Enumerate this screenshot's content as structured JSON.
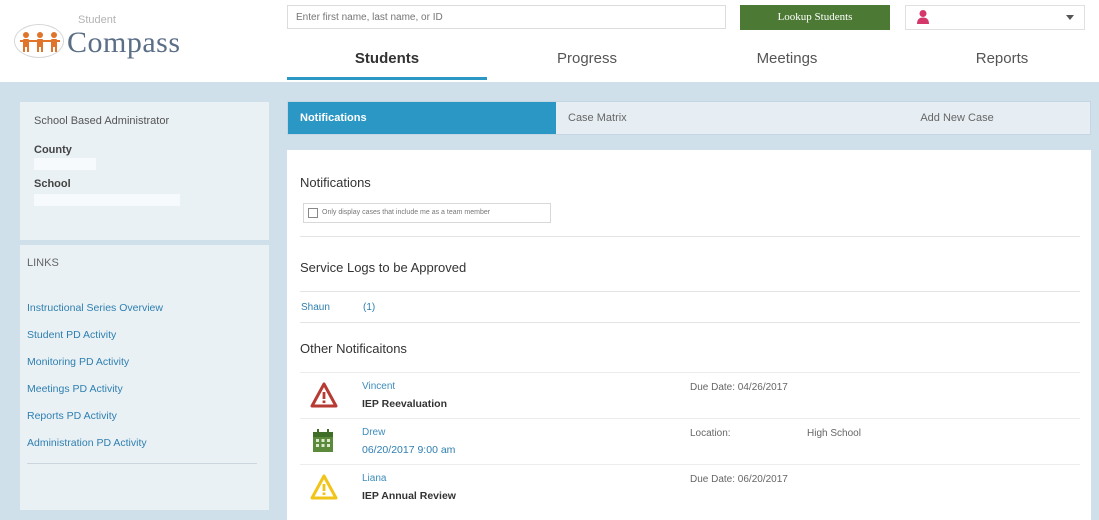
{
  "header": {
    "logo_small": "Student",
    "logo_big": "Compass",
    "search_placeholder": "Enter first name, last name, or ID",
    "lookup_label": "Lookup Students",
    "user_icon": "user-icon"
  },
  "nav": {
    "tabs": [
      {
        "label": "Students",
        "active": true
      },
      {
        "label": "Progress",
        "active": false
      },
      {
        "label": "Meetings",
        "active": false
      },
      {
        "label": "Reports",
        "active": false
      }
    ]
  },
  "sidebar": {
    "role": "School Based Administrator",
    "county_label": "County",
    "school_label": "School",
    "links_heading": "LINKS",
    "links": [
      "Instructional Series Overview",
      "Student PD Activity",
      "Monitoring PD Activity",
      "Meetings PD Activity",
      "Reports PD Activity",
      "Administration PD Activity"
    ]
  },
  "subtabs": [
    {
      "label": "Notifications",
      "active": true
    },
    {
      "label": "Case Matrix",
      "active": false
    },
    {
      "label": "Add New Case",
      "active": false
    }
  ],
  "main": {
    "heading": "Notifications",
    "checkbox_label": "Only display cases that include me as a team member",
    "service_heading": "Service Logs to be Approved",
    "service_name": "Shaun",
    "service_count": "(1)",
    "other_heading": "Other Notificaitons",
    "notifications": [
      {
        "icon": "warning-red-icon",
        "name": "Vincent",
        "desc": "IEP Reevaluation",
        "desc_link": false,
        "meta": "Due Date: 04/26/2017",
        "meta2": ""
      },
      {
        "icon": "calendar-icon",
        "name": "Drew",
        "desc": "06/20/2017 9:00 am",
        "desc_link": true,
        "meta": "Location:",
        "meta2": "High School"
      },
      {
        "icon": "warning-yellow-icon",
        "name": "Liana",
        "desc": "IEP Annual Review",
        "desc_link": false,
        "meta": "Due Date: 06/20/2017",
        "meta2": ""
      }
    ]
  },
  "colors": {
    "accent": "#2b97c5",
    "lookup_green": "#4c7a34",
    "warning_red": "#b73a33",
    "warning_yellow": "#f0c419",
    "calendar_green": "#5a8a3a"
  }
}
